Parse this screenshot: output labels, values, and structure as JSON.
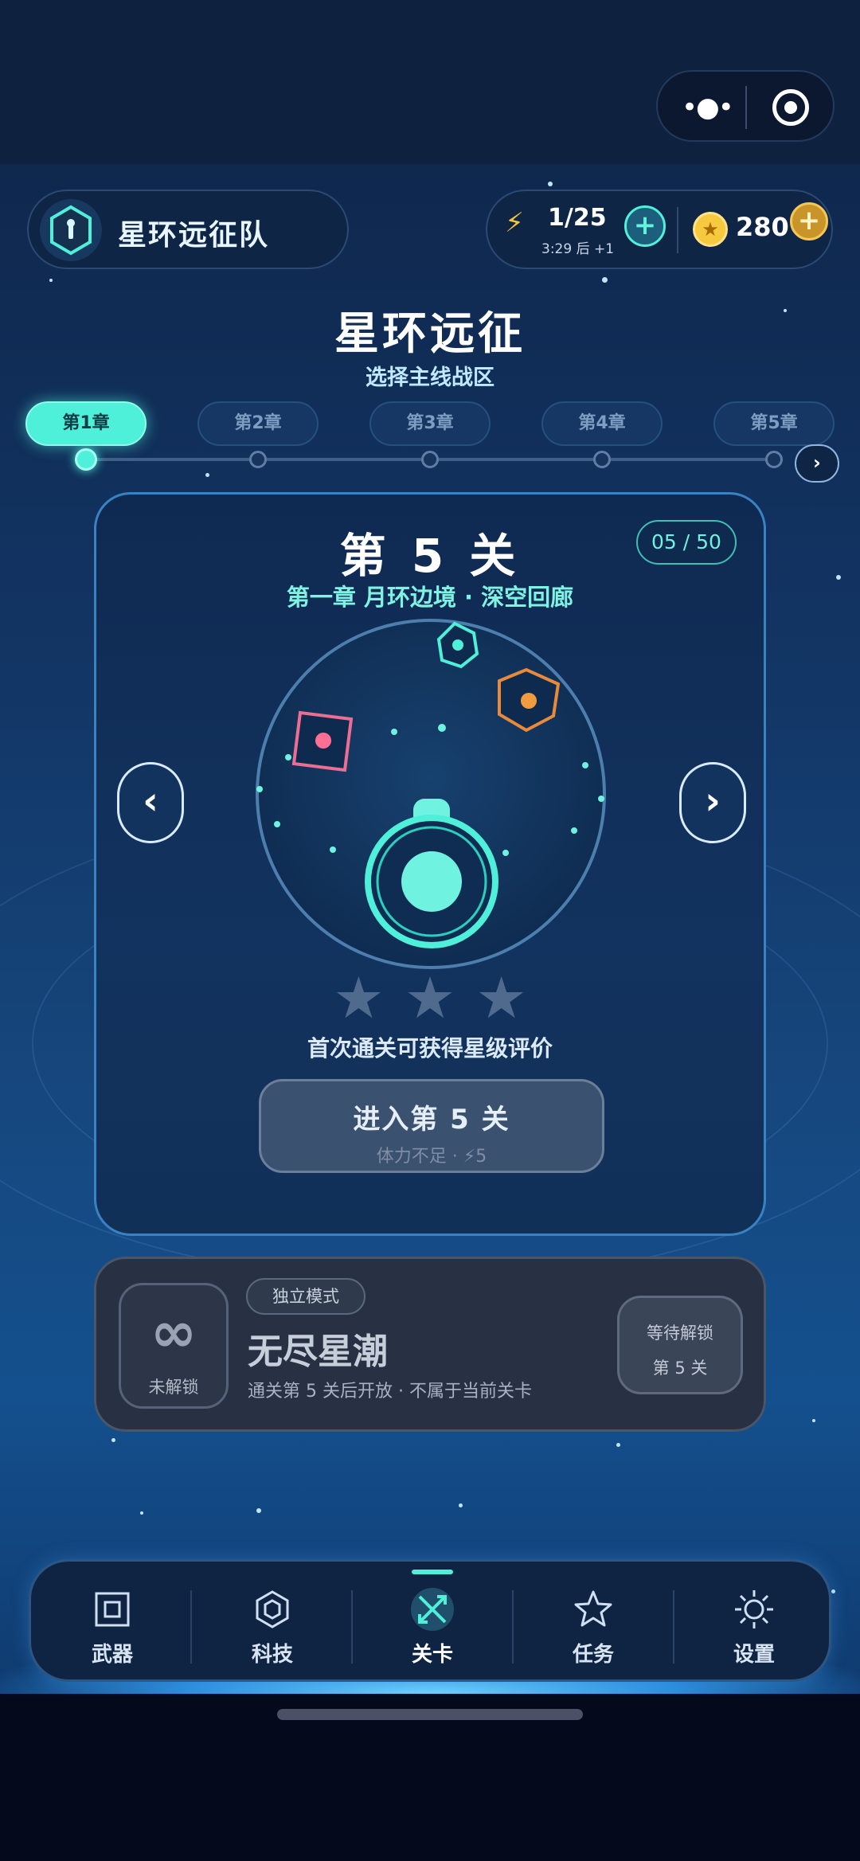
{
  "team": {
    "name": "星环远征队"
  },
  "resources": {
    "energy": "1/25",
    "energy_timer": "3:29 后 +1",
    "coins": "280",
    "plus": "+"
  },
  "header": {
    "title": "星环远征",
    "subtitle": "选择主线战区"
  },
  "chapters": [
    "第1章",
    "第2章",
    "第3章",
    "第4章",
    "第5章"
  ],
  "active_chapter_index": 0,
  "stage_card": {
    "title": "第 5 关",
    "progress": "05 / 50",
    "location": "第一章 月环边境 · 深空回廊",
    "stars_earned": 0,
    "stars_total": 3,
    "hint": "首次通关可获得星级评价",
    "enter_label": "进入第 5 关",
    "enter_note": "体力不足 · ⚡5",
    "prev": "‹",
    "next": "›"
  },
  "endless": {
    "symbol": "∞",
    "locked_label": "未解锁",
    "mode_tag": "独立模式",
    "title": "无尽星潮",
    "desc": "通关第 5 关后开放 · 不属于当前关卡",
    "wait_line1": "等待解锁",
    "wait_line2": "第 5 关"
  },
  "nav": [
    {
      "label": "武器",
      "icon": "square-icon"
    },
    {
      "label": "科技",
      "icon": "hexagon-icon"
    },
    {
      "label": "关卡",
      "icon": "crossed-swords-icon"
    },
    {
      "label": "任务",
      "icon": "star-icon"
    },
    {
      "label": "设置",
      "icon": "sun-gear-icon"
    }
  ],
  "active_nav_index": 2,
  "colors": {
    "accent": "#4ff0d9",
    "coin": "#f7c93e",
    "energy": "#f5c542"
  }
}
